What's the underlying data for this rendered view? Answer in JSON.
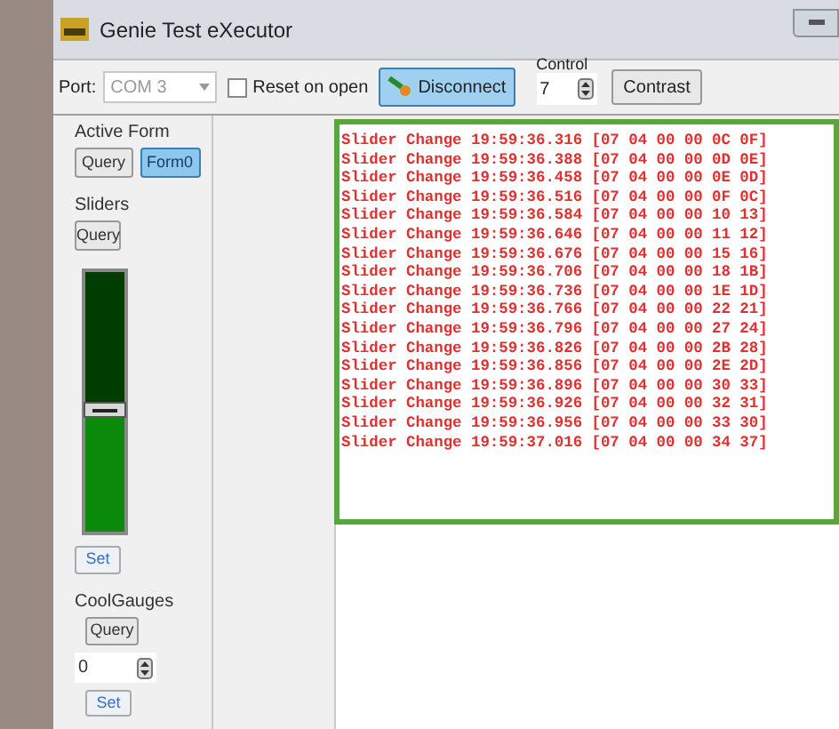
{
  "window": {
    "title": "Genie Test eXecutor"
  },
  "toolbar": {
    "port_label": "Port:",
    "port": {
      "value": "COM 3",
      "disabled": true
    },
    "reset_on_open": {
      "label": "Reset on open",
      "checked": false
    },
    "connect_button": {
      "label": "Disconnect",
      "selected": true
    },
    "control": {
      "label": "Control",
      "value": "7"
    },
    "contrast_button": "Contrast"
  },
  "active_form": {
    "title": "Active Form",
    "buttons": [
      {
        "label": "Query",
        "selected": false
      },
      {
        "label": "Form0",
        "selected": true
      }
    ]
  },
  "sliders": {
    "title": "Sliders",
    "query_button": "Query",
    "level": 0.47,
    "set_button": "Set"
  },
  "cool_gauges": {
    "title": "CoolGauges",
    "query_button": "Query",
    "value": "0",
    "set_button": "Set"
  },
  "log": [
    "Slider Change 19:59:36.316 [07 04 00 00 0C 0F]",
    "Slider Change 19:59:36.388 [07 04 00 00 0D 0E]",
    "Slider Change 19:59:36.458 [07 04 00 00 0E 0D]",
    "Slider Change 19:59:36.516 [07 04 00 00 0F 0C]",
    "Slider Change 19:59:36.584 [07 04 00 00 10 13]",
    "Slider Change 19:59:36.646 [07 04 00 00 11 12]",
    "Slider Change 19:59:36.676 [07 04 00 00 15 16]",
    "Slider Change 19:59:36.706 [07 04 00 00 18 1B]",
    "Slider Change 19:59:36.736 [07 04 00 00 1E 1D]",
    "Slider Change 19:59:36.766 [07 04 00 00 22 21]",
    "Slider Change 19:59:36.796 [07 04 00 00 27 24]",
    "Slider Change 19:59:36.826 [07 04 00 00 2B 28]",
    "Slider Change 19:59:36.856 [07 04 00 00 2E 2D]",
    "Slider Change 19:59:36.896 [07 04 00 00 30 33]",
    "Slider Change 19:59:36.926 [07 04 00 00 32 31]",
    "Slider Change 19:59:36.956 [07 04 00 00 33 30]",
    "Slider Change 19:59:37.016 [07 04 00 00 34 37]"
  ]
}
